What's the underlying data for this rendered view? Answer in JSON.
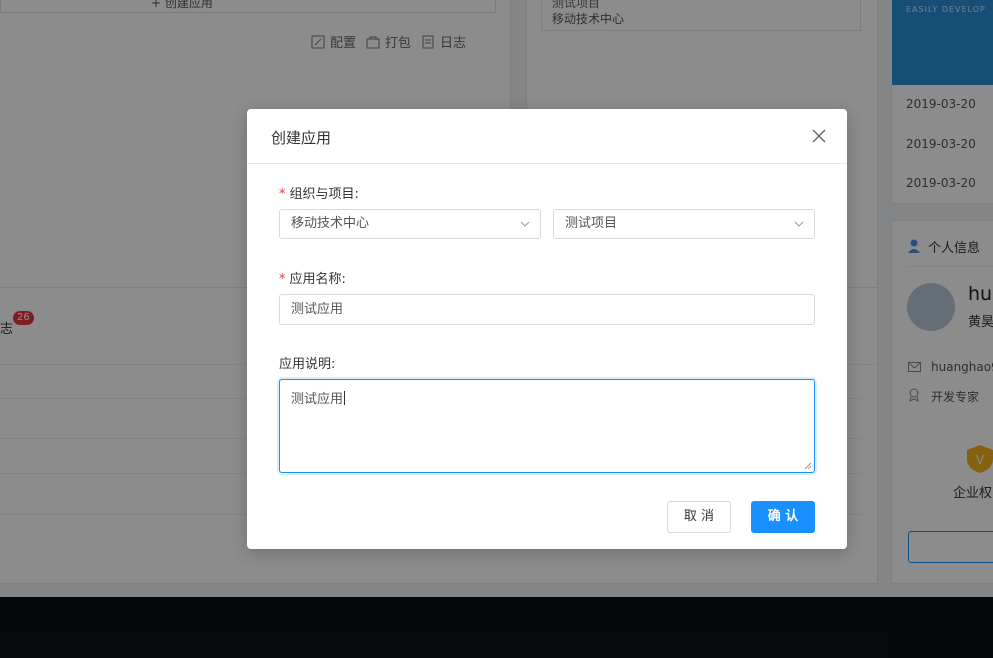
{
  "background": {
    "top_button_label": "+ 创建应用",
    "actions": {
      "config": "配置",
      "pack": "打包",
      "log": "日志"
    },
    "project_card": {
      "title": "测试项目",
      "subtitle": "移动技术中心"
    },
    "banner_text": "EASILY DEVELOP",
    "dates": [
      "2019-03-20",
      "2019-03-20",
      "2019-03-20"
    ],
    "log_tab": {
      "label": "志",
      "badge": "26"
    },
    "profile": {
      "section_title": "个人信息",
      "username_partial": "hua",
      "name_partial": "黄昊",
      "email_partial": "huanghao9",
      "role": "开发专家",
      "enterprise_partial": "企业权"
    }
  },
  "modal": {
    "title": "创建应用",
    "org_project_label": "组织与项目:",
    "org_select_value": "移动技术中心",
    "project_select_value": "测试项目",
    "app_name_label": "应用名称:",
    "app_name_value": "测试应用",
    "app_desc_label": "应用说明:",
    "app_desc_value": "测试应用",
    "cancel_label": "取 消",
    "confirm_label": "确 认"
  },
  "colors": {
    "primary": "#1890ff",
    "required": "#e4393c",
    "badge": "#e4393c"
  }
}
